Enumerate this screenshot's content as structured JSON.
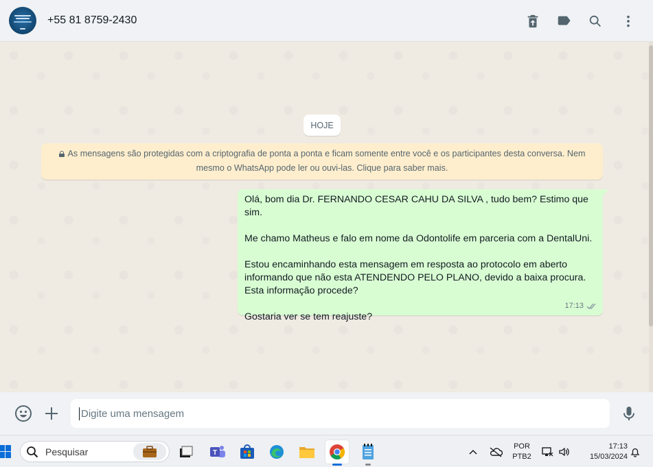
{
  "header": {
    "contact_name": "+55 81 8759-2430",
    "avatar_icon": "profile-photo",
    "actions": [
      "delete-icon",
      "label-icon",
      "search-icon",
      "menu-icon"
    ]
  },
  "chat": {
    "date_chip": "HOJE",
    "encryption_notice": "As mensagens são protegidas com a criptografia de ponta a ponta e ficam somente entre você e os participantes desta conversa. Nem mesmo o WhatsApp pode ler ou ouvi-las. Clique para saber mais.",
    "message": {
      "paragraphs": [
        "Olá, bom dia Dr. FERNANDO CESAR CAHU DA SILVA , tudo bem? Estimo que sim.",
        "Me chamo Matheus e falo em nome da Odontolife em parceria com a DentalUni.",
        "Estou encaminhando esta mensagem em resposta ao protocolo em aberto informando que não esta ATENDENDO PELO PLANO, devido a baixa procura. Esta informação procede?",
        "Gostaria ver se tem reajuste?"
      ],
      "time": "17:13",
      "status_icon": "double-check-icon"
    }
  },
  "composer": {
    "placeholder": "Digite uma mensagem",
    "emoji_icon": "emoji-icon",
    "attach_icon": "plus-icon",
    "mic_icon": "mic-icon"
  },
  "taskbar": {
    "search_placeholder": "Pesquisar",
    "apps": [
      "file-explorer-icon",
      "teams-icon",
      "store-icon",
      "edge-icon",
      "folder-icon",
      "chrome-icon",
      "notepad-icon"
    ],
    "active_app": "chrome-icon",
    "language_line1": "POR",
    "language_line2": "PTB2",
    "time": "17:13",
    "date": "15/03/2024"
  },
  "colors": {
    "header_bg": "#f0f2f5",
    "chat_bg": "#efeae2",
    "outgoing_bubble": "#d9fdd3",
    "notice_bg": "#ffeecd",
    "icon_gray": "#54656f"
  }
}
